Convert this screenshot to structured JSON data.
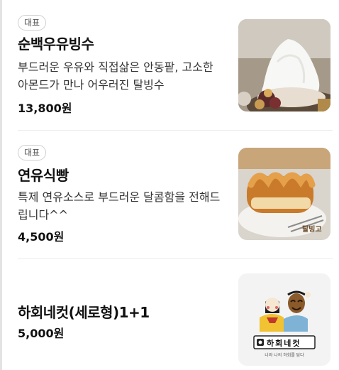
{
  "menu": {
    "items": [
      {
        "badge": "대표",
        "name": "순백우유빙수",
        "description": "부드러운 우유와 직접삶은 안동팥, 고소한 아몬드가 만나 어우러진 탈빙수",
        "price": "13,800원",
        "image": "bingsu-photo"
      },
      {
        "badge": "대표",
        "name": "연유식빵",
        "description": "특제 연유소스로 부드러운 달콤함을 전해드립니다^^",
        "price": "4,500원",
        "image": "bread-photo",
        "image_watermark": "탈빙고"
      },
      {
        "name": "하회네컷(세로형)1+1",
        "price": "5,000원",
        "image": "hahoe-photo-booth-logo",
        "image_logo_text": "하회네컷",
        "image_tagline": "너와 나의 하회를 담다"
      }
    ]
  },
  "colors": {
    "text": "#111111",
    "desc": "#333333",
    "badge_border": "#cfcfcf",
    "divider": "#ececec"
  }
}
